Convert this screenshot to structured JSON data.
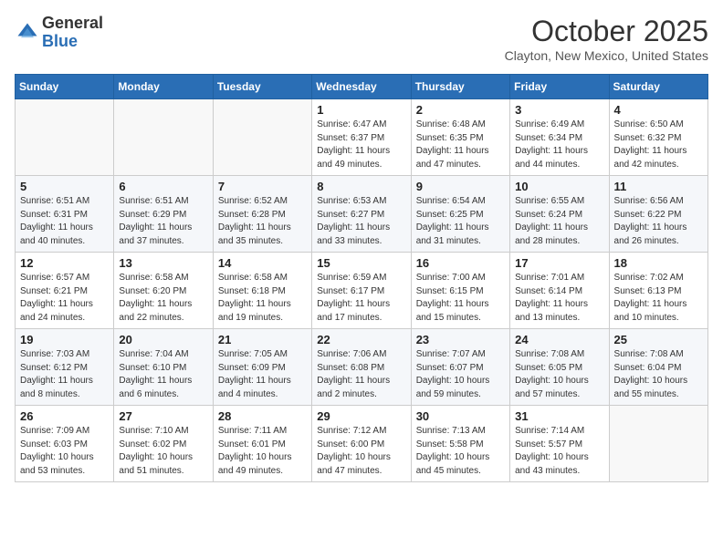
{
  "logo": {
    "general": "General",
    "blue": "Blue"
  },
  "title": "October 2025",
  "location": "Clayton, New Mexico, United States",
  "days_of_week": [
    "Sunday",
    "Monday",
    "Tuesday",
    "Wednesday",
    "Thursday",
    "Friday",
    "Saturday"
  ],
  "weeks": [
    [
      {
        "day": "",
        "info": ""
      },
      {
        "day": "",
        "info": ""
      },
      {
        "day": "",
        "info": ""
      },
      {
        "day": "1",
        "info": "Sunrise: 6:47 AM\nSunset: 6:37 PM\nDaylight: 11 hours\nand 49 minutes."
      },
      {
        "day": "2",
        "info": "Sunrise: 6:48 AM\nSunset: 6:35 PM\nDaylight: 11 hours\nand 47 minutes."
      },
      {
        "day": "3",
        "info": "Sunrise: 6:49 AM\nSunset: 6:34 PM\nDaylight: 11 hours\nand 44 minutes."
      },
      {
        "day": "4",
        "info": "Sunrise: 6:50 AM\nSunset: 6:32 PM\nDaylight: 11 hours\nand 42 minutes."
      }
    ],
    [
      {
        "day": "5",
        "info": "Sunrise: 6:51 AM\nSunset: 6:31 PM\nDaylight: 11 hours\nand 40 minutes."
      },
      {
        "day": "6",
        "info": "Sunrise: 6:51 AM\nSunset: 6:29 PM\nDaylight: 11 hours\nand 37 minutes."
      },
      {
        "day": "7",
        "info": "Sunrise: 6:52 AM\nSunset: 6:28 PM\nDaylight: 11 hours\nand 35 minutes."
      },
      {
        "day": "8",
        "info": "Sunrise: 6:53 AM\nSunset: 6:27 PM\nDaylight: 11 hours\nand 33 minutes."
      },
      {
        "day": "9",
        "info": "Sunrise: 6:54 AM\nSunset: 6:25 PM\nDaylight: 11 hours\nand 31 minutes."
      },
      {
        "day": "10",
        "info": "Sunrise: 6:55 AM\nSunset: 6:24 PM\nDaylight: 11 hours\nand 28 minutes."
      },
      {
        "day": "11",
        "info": "Sunrise: 6:56 AM\nSunset: 6:22 PM\nDaylight: 11 hours\nand 26 minutes."
      }
    ],
    [
      {
        "day": "12",
        "info": "Sunrise: 6:57 AM\nSunset: 6:21 PM\nDaylight: 11 hours\nand 24 minutes."
      },
      {
        "day": "13",
        "info": "Sunrise: 6:58 AM\nSunset: 6:20 PM\nDaylight: 11 hours\nand 22 minutes."
      },
      {
        "day": "14",
        "info": "Sunrise: 6:58 AM\nSunset: 6:18 PM\nDaylight: 11 hours\nand 19 minutes."
      },
      {
        "day": "15",
        "info": "Sunrise: 6:59 AM\nSunset: 6:17 PM\nDaylight: 11 hours\nand 17 minutes."
      },
      {
        "day": "16",
        "info": "Sunrise: 7:00 AM\nSunset: 6:15 PM\nDaylight: 11 hours\nand 15 minutes."
      },
      {
        "day": "17",
        "info": "Sunrise: 7:01 AM\nSunset: 6:14 PM\nDaylight: 11 hours\nand 13 minutes."
      },
      {
        "day": "18",
        "info": "Sunrise: 7:02 AM\nSunset: 6:13 PM\nDaylight: 11 hours\nand 10 minutes."
      }
    ],
    [
      {
        "day": "19",
        "info": "Sunrise: 7:03 AM\nSunset: 6:12 PM\nDaylight: 11 hours\nand 8 minutes."
      },
      {
        "day": "20",
        "info": "Sunrise: 7:04 AM\nSunset: 6:10 PM\nDaylight: 11 hours\nand 6 minutes."
      },
      {
        "day": "21",
        "info": "Sunrise: 7:05 AM\nSunset: 6:09 PM\nDaylight: 11 hours\nand 4 minutes."
      },
      {
        "day": "22",
        "info": "Sunrise: 7:06 AM\nSunset: 6:08 PM\nDaylight: 11 hours\nand 2 minutes."
      },
      {
        "day": "23",
        "info": "Sunrise: 7:07 AM\nSunset: 6:07 PM\nDaylight: 10 hours\nand 59 minutes."
      },
      {
        "day": "24",
        "info": "Sunrise: 7:08 AM\nSunset: 6:05 PM\nDaylight: 10 hours\nand 57 minutes."
      },
      {
        "day": "25",
        "info": "Sunrise: 7:08 AM\nSunset: 6:04 PM\nDaylight: 10 hours\nand 55 minutes."
      }
    ],
    [
      {
        "day": "26",
        "info": "Sunrise: 7:09 AM\nSunset: 6:03 PM\nDaylight: 10 hours\nand 53 minutes."
      },
      {
        "day": "27",
        "info": "Sunrise: 7:10 AM\nSunset: 6:02 PM\nDaylight: 10 hours\nand 51 minutes."
      },
      {
        "day": "28",
        "info": "Sunrise: 7:11 AM\nSunset: 6:01 PM\nDaylight: 10 hours\nand 49 minutes."
      },
      {
        "day": "29",
        "info": "Sunrise: 7:12 AM\nSunset: 6:00 PM\nDaylight: 10 hours\nand 47 minutes."
      },
      {
        "day": "30",
        "info": "Sunrise: 7:13 AM\nSunset: 5:58 PM\nDaylight: 10 hours\nand 45 minutes."
      },
      {
        "day": "31",
        "info": "Sunrise: 7:14 AM\nSunset: 5:57 PM\nDaylight: 10 hours\nand 43 minutes."
      },
      {
        "day": "",
        "info": ""
      }
    ]
  ]
}
